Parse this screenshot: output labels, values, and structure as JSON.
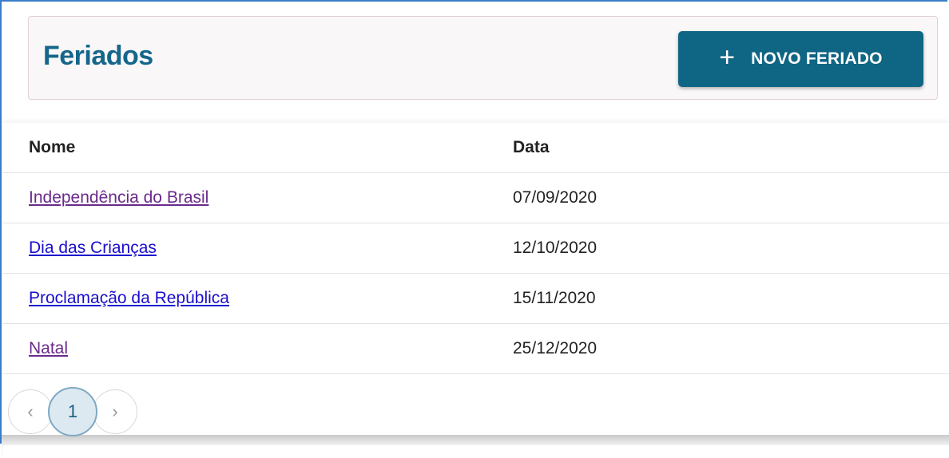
{
  "header": {
    "title": "Feriados",
    "new_button_icon": "plus-icon",
    "new_button_plus": "+",
    "new_button_label": "NOVO FERIADO"
  },
  "table": {
    "columns": [
      "Nome",
      "Data"
    ],
    "rows": [
      {
        "name": "Independência do Brasil",
        "date": "07/09/2020",
        "visited": true
      },
      {
        "name": "Dia das Crianças",
        "date": "12/10/2020",
        "visited": false
      },
      {
        "name": "Proclamação da República",
        "date": "15/11/2020",
        "visited": false
      },
      {
        "name": "Natal",
        "date": "25/12/2020",
        "visited": true
      }
    ]
  },
  "pagination": {
    "prev": "‹",
    "current": "1",
    "next": "›"
  },
  "colors": {
    "brand": "#0f6584",
    "title": "#15668a",
    "visited_link": "#6a2a8c",
    "link": "#1a0dcc"
  }
}
